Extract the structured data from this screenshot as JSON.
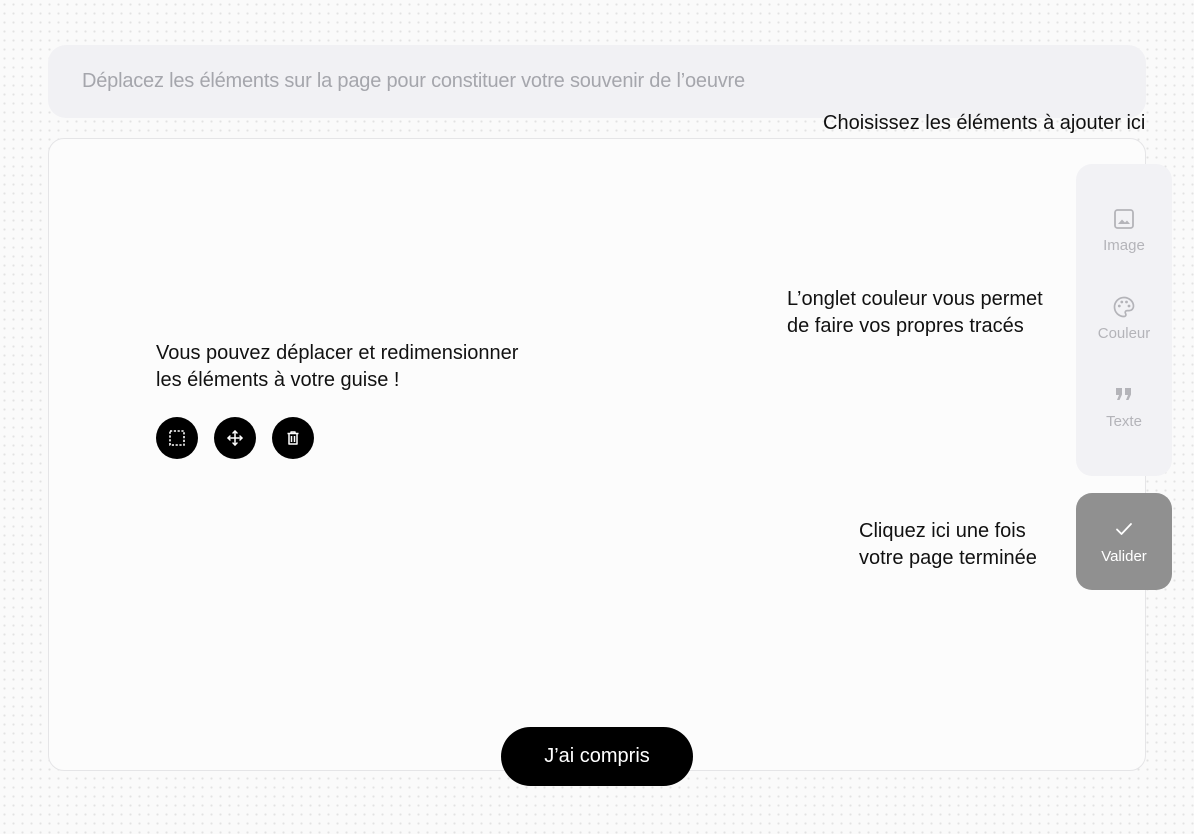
{
  "instruction": {
    "text": "Déplacez les éléments  sur la page pour constituer votre souvenir de l’oeuvre"
  },
  "hints": {
    "panel": "Choisissez les éléments à ajouter ici",
    "move_line1": "Vous pouvez déplacer et redimensionner",
    "move_line2": "les éléments à votre guise !",
    "color_line1": "L’onglet couleur vous permet",
    "color_line2": "de faire vos propres tracés",
    "validate_line1": "Cliquez ici une fois",
    "validate_line2": "votre page terminée"
  },
  "tools": [
    {
      "icon": "resize-icon"
    },
    {
      "icon": "move-icon"
    },
    {
      "icon": "trash-icon"
    }
  ],
  "panel": {
    "items": [
      {
        "label": "Image",
        "icon": "image-icon"
      },
      {
        "label": "Couleur",
        "icon": "palette-icon"
      },
      {
        "label": "Texte",
        "icon": "quote-icon"
      }
    ]
  },
  "validate": {
    "label": "Valider",
    "icon": "check-icon"
  },
  "cta": {
    "label": "J’ai compris"
  },
  "colors": {
    "accent": "#000000",
    "panel_bg": "#f2f2f5",
    "validate_bg": "#909090",
    "muted_text": "#b4b4b9"
  }
}
